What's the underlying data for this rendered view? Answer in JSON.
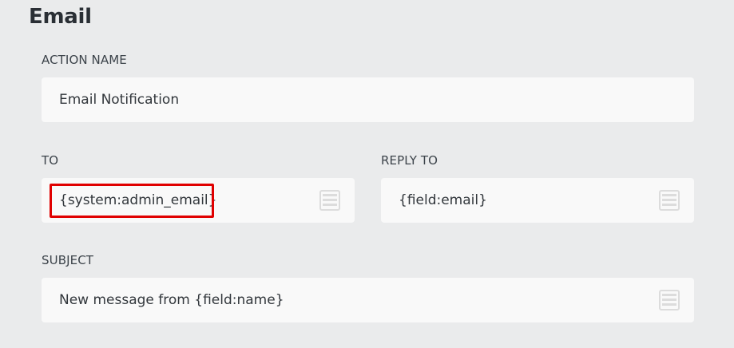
{
  "section": {
    "title": "Email"
  },
  "action_name": {
    "label": "ACTION NAME",
    "value": "Email Notification"
  },
  "to": {
    "label": "TO",
    "value": "{system:admin_email}",
    "icon": "merge-tags-icon"
  },
  "reply_to": {
    "label": "REPLY TO",
    "value": "{field:email}",
    "icon": "merge-tags-icon"
  },
  "subject": {
    "label": "SUBJECT",
    "value": "New message from {field:name}",
    "icon": "merge-tags-icon"
  },
  "colors": {
    "highlight": "#e00000",
    "icon": "#dcdcdc"
  }
}
